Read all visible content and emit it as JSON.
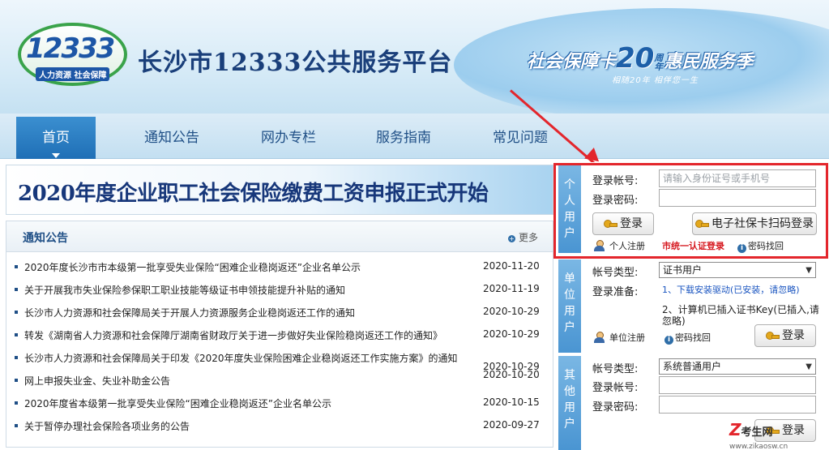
{
  "header": {
    "logo_number": "12333",
    "logo_subtitle": "人力资源 社会保障",
    "site_title": "长沙市12333公共服务平台",
    "banner_left": "社会保障卡",
    "banner_num": "20",
    "banner_zhou": "周年",
    "banner_right": "惠民服务季",
    "banner_sub": "相随20年 相伴您一生"
  },
  "nav": {
    "items": [
      {
        "label": "首页",
        "active": true
      },
      {
        "label": "通知公告"
      },
      {
        "label": "网办专栏"
      },
      {
        "label": "服务指南"
      },
      {
        "label": "常见问题"
      }
    ]
  },
  "headline": "2020年度企业职工社会保险缴费工资申报正式开始",
  "notices": {
    "title": "通知公告",
    "more": "更多",
    "items": [
      {
        "title": "2020年度长沙市市本级第一批享受失业保险“困难企业稳岗返还”企业名单公示",
        "date": "2020-11-20"
      },
      {
        "title": "关于开展我市失业保险参保职工职业技能等级证书申领技能提升补贴的通知",
        "date": "2020-11-19"
      },
      {
        "title": "长沙市人力资源和社会保障局关于开展人力资源服务企业稳岗返还工作的通知",
        "date": "2020-10-29"
      },
      {
        "title": "转发《湖南省人力资源和社会保障厅湖南省财政厅关于进一步做好失业保险稳岗返还工作的通知》",
        "date": "2020-10-29"
      },
      {
        "title": "长沙市人力资源和社会保障局关于印发《2020年度失业保险困难企业稳岗返还工作实施方案》的通知",
        "date": "2020-10-29"
      },
      {
        "title": "网上申报失业金、失业补助金公告",
        "date": "2020-10-20"
      },
      {
        "title": "2020年度省本级第一批享受失业保险“困难企业稳岗返还”企业名单公示",
        "date": "2020-10-15"
      },
      {
        "title": "关于暂停办理社会保险各项业务的公告",
        "date": "2020-09-27"
      }
    ]
  },
  "personal": {
    "tab": [
      "个",
      "人",
      "用",
      "户"
    ],
    "account_label": "登录帐号:",
    "account_placeholder": "请输入身份证号或手机号",
    "password_label": "登录密码:",
    "login_button": "登录",
    "qr_login_button": "电子社保卡扫码登录",
    "register": "个人注册",
    "unified_login": "市统一认证登录",
    "recover": "密码找回"
  },
  "unit": {
    "tab": [
      "单",
      "位",
      "用",
      "户"
    ],
    "account_type_label": "帐号类型:",
    "account_type_value": "证书用户",
    "prep_label": "登录准备:",
    "prep_1": "1、下载安装驱动(已安装，请忽略)",
    "prep_2a": "2、计算机已插入证书Key(已插入,请",
    "prep_2b": "忽略)",
    "register": "单位注册",
    "recover": "密码找回",
    "login_button": "登录"
  },
  "other": {
    "tab": [
      "其",
      "他",
      "用",
      "户"
    ],
    "account_type_label": "帐号类型:",
    "account_type_value": "系统普通用户",
    "account_label": "登录帐号:",
    "password_label": "登录密码:",
    "login_button": "登录"
  },
  "watermark": {
    "brand": "考生网",
    "site": "www.zikaosw.cn"
  },
  "colors": {
    "nav_active": "#1f6fb6",
    "title_blue": "#1a3f7a",
    "highlight_red": "#e3262c"
  }
}
